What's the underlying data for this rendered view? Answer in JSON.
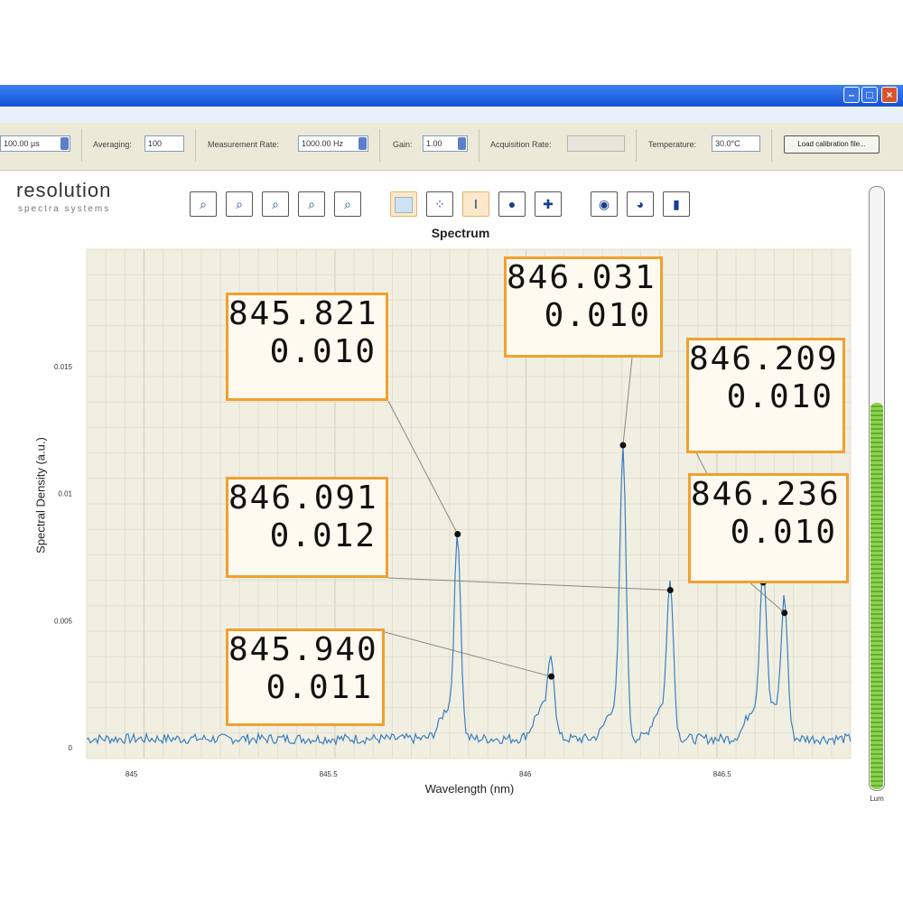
{
  "toolbar": {
    "exposure_value": "100.00 µs",
    "averaging_label": "Averaging:",
    "averaging_value": "100",
    "measurement_rate_label": "Measurement Rate:",
    "measurement_rate_value": "1000.00 Hz",
    "gain_label": "Gain:",
    "gain_value": "1.00",
    "acquisition_rate_label": "Acquisition Rate:",
    "acquisition_rate_value": "",
    "temperature_label": "Temperature:",
    "temperature_value": "30.0°C",
    "load_calibration_label": "Load calibration file..."
  },
  "window": {
    "min_icon": "minimize-icon",
    "max_icon": "maximize-icon",
    "close_icon": "close-icon"
  },
  "logo": {
    "main": "resolution",
    "sub": "spectra systems"
  },
  "icons": [
    "zoom-in-icon",
    "zoom-fit-icon",
    "zoom-out-icon",
    "zoom-x-icon",
    "zoom-y-icon",
    "line-mode-icon",
    "point-mode-icon",
    "cursor-mode-icon",
    "camera-icon",
    "export-icon",
    "save-icon",
    "print-icon",
    "document-icon"
  ],
  "chart_data": {
    "type": "line",
    "title": "Spectrum",
    "xlabel": "Wavelength (nm)",
    "ylabel": "Spectral Density (a.u.)",
    "xlim": [
      845.35,
      846.32
    ],
    "ylim": [
      0,
      0.02
    ],
    "xticks": [
      "845",
      "845.5",
      "846",
      "846.5"
    ],
    "yticks": [
      "0",
      "0.005",
      "0.01",
      "0.015"
    ],
    "grid": true,
    "series": [
      {
        "color": "#3a7fc1",
        "peaks": [
          {
            "x": 845.821,
            "y": 0.0075
          },
          {
            "x": 845.94,
            "y": 0.0027
          },
          {
            "x": 846.031,
            "y": 0.0108
          },
          {
            "x": 846.091,
            "y": 0.0058
          },
          {
            "x": 846.209,
            "y": 0.006
          },
          {
            "x": 846.236,
            "y": 0.005
          }
        ]
      }
    ],
    "annotations": [
      {
        "wavelength": "845.821",
        "value": "0.010",
        "peak_x": 845.821,
        "peak_y": 0.0084
      },
      {
        "wavelength": "846.031",
        "value": "0.010",
        "peak_x": 846.031,
        "peak_y": 0.0119
      },
      {
        "wavelength": "846.209",
        "value": "0.010",
        "peak_x": 846.209,
        "peak_y": 0.0065
      },
      {
        "wavelength": "846.091",
        "value": "0.012",
        "peak_x": 846.091,
        "peak_y": 0.0062
      },
      {
        "wavelength": "846.236",
        "value": "0.010",
        "peak_x": 846.236,
        "peak_y": 0.0053
      },
      {
        "wavelength": "845.940",
        "value": "0.011",
        "peak_x": 845.94,
        "peak_y": 0.0028
      }
    ]
  },
  "sidebar": {
    "level": 0.64,
    "caption": "Lum"
  }
}
